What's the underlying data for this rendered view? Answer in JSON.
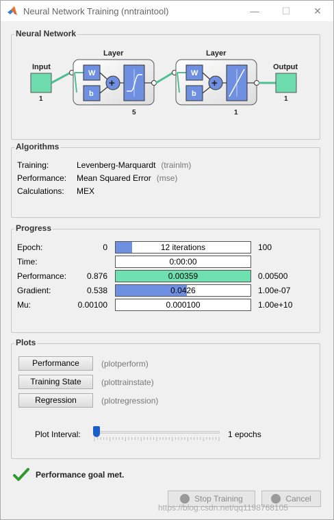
{
  "window": {
    "title": "Neural Network Training (nntraintool)",
    "minimize_glyph": "—",
    "maximize_glyph": "☐",
    "close_glyph": "✕"
  },
  "network": {
    "panel_title": "Neural Network",
    "input_label": "Input",
    "input_size": "1",
    "hidden_layer_label": "Layer",
    "hidden_layer_size": "5",
    "output_layer_label": "Layer",
    "output_layer_size": "1",
    "output_label": "Output",
    "output_size": "1",
    "weight_symbol": "W",
    "bias_symbol": "b",
    "sum_symbol": "+"
  },
  "algorithms": {
    "panel_title": "Algorithms",
    "rows": [
      {
        "label": "Training:",
        "value": "Levenberg-Marquardt",
        "func": "(trainlm)"
      },
      {
        "label": "Performance:",
        "value": "Mean Squared Error",
        "func": "(mse)"
      },
      {
        "label": "Calculations:",
        "value": "MEX",
        "func": ""
      }
    ]
  },
  "progress": {
    "panel_title": "Progress",
    "rows": [
      {
        "label": "Epoch:",
        "start": "0",
        "value": "12 iterations",
        "end": "100",
        "fill": 0.12,
        "fill_color": "#6f8fe0"
      },
      {
        "label": "Time:",
        "start": "",
        "value": "0:00:00",
        "end": "",
        "fill": 0,
        "fill_color": "#6f8fe0"
      },
      {
        "label": "Performance:",
        "start": "0.876",
        "value": "0.00359",
        "end": "0.00500",
        "fill": 1.0,
        "fill_color": "#6fe0b0"
      },
      {
        "label": "Gradient:",
        "start": "0.538",
        "value": "0.0426",
        "end": "1.00e-07",
        "fill": 0.53,
        "fill_color": "#6f8fe0"
      },
      {
        "label": "Mu:",
        "start": "0.00100",
        "value": "0.000100",
        "end": "1.00e+10",
        "fill": 0,
        "fill_color": "#6f8fe0"
      }
    ]
  },
  "plots": {
    "panel_title": "Plots",
    "buttons": [
      {
        "label": "Performance",
        "func": "(plotperform)"
      },
      {
        "label": "Training State",
        "func": "(plottrainstate)"
      },
      {
        "label": "Regression",
        "func": "(plotregression)"
      }
    ],
    "interval_label": "Plot Interval:",
    "interval_value": "1 epochs",
    "interval_level": 0.02
  },
  "status": {
    "message": "Performance goal met.",
    "check_color": "#2e9a2e"
  },
  "footer": {
    "stop_label": "Stop Training",
    "cancel_label": "Cancel"
  },
  "watermark": "https://blog.csdn.net/qq1198768105"
}
